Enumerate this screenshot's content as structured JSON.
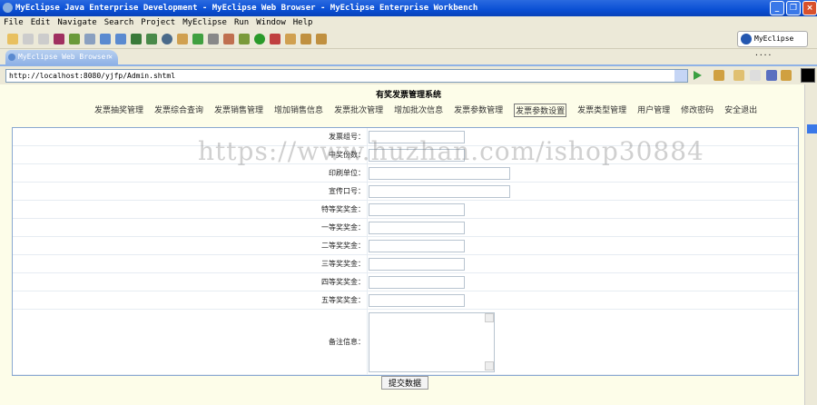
{
  "window": {
    "title": "MyEclipse Java Enterprise Development - MyEclipse Web Browser - MyEclipse Enterprise Workbench"
  },
  "menu": [
    "File",
    "Edit",
    "Navigate",
    "Search",
    "Project",
    "MyEclipse",
    "Run",
    "Window",
    "Help"
  ],
  "perspective": "MyEclipse ....",
  "tab": {
    "label": "MyEclipse Web Browser"
  },
  "url": "http://localhost:8080/yjfp/Admin.shtml",
  "page": {
    "title": "有奖发票管理系统",
    "nav": [
      "发票抽奖管理",
      "发票综合查询",
      "发票销售管理",
      "增加销售信息",
      "发票批次管理",
      "增加批次信息",
      "发票参数管理",
      "发票参数设置",
      "发票类型管理",
      "用户管理",
      "修改密码",
      "安全退出"
    ],
    "active_nav": "发票参数设置",
    "fields": [
      {
        "label": "发票组号：",
        "value": ""
      },
      {
        "label": "中奖份数：",
        "value": ""
      },
      {
        "label": "印刷单位：",
        "value": ""
      },
      {
        "label": "宣传口号：",
        "value": ""
      },
      {
        "label": "特等奖奖金：",
        "value": ""
      },
      {
        "label": "一等奖奖金：",
        "value": ""
      },
      {
        "label": "二等奖奖金：",
        "value": ""
      },
      {
        "label": "三等奖奖金：",
        "value": ""
      },
      {
        "label": "四等奖奖金：",
        "value": ""
      },
      {
        "label": "五等奖奖金：",
        "value": ""
      }
    ],
    "remark_label": "备注信息：",
    "submit": "提交数据"
  },
  "watermark": "https://www.huzhan.com/ishop30884"
}
